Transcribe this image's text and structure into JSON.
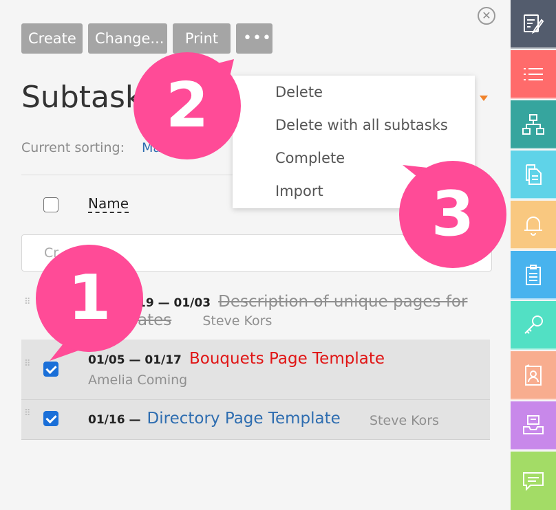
{
  "toolbar": {
    "create_label": "Create",
    "change_label": "Change...",
    "print_label": "Print",
    "more_label": "•••"
  },
  "panel": {
    "title": "Subtasks",
    "sorting_label": "Current sorting:",
    "sorting_value": "Ma"
  },
  "table": {
    "name_header": "Name",
    "new_task_placeholder": "Cr"
  },
  "rows": [
    {
      "dates": "19 — 01/03",
      "name": "Description of unique pages for",
      "name_cont": "ates",
      "assignee": "Steve Kors",
      "checked": false,
      "status": "completed"
    },
    {
      "dates": "01/05 — 01/17",
      "name": "Bouquets Page Template",
      "assignee": "Amelia Coming",
      "checked": true,
      "status": "overdue"
    },
    {
      "dates": "01/16 —",
      "name": "Directory Page Template",
      "assignee": "Steve Kors",
      "checked": true,
      "status": "normal"
    }
  ],
  "menu": {
    "items": [
      "Delete",
      "Delete with all subtasks",
      "Complete",
      "Import"
    ]
  },
  "badges": [
    "1",
    "2",
    "3"
  ],
  "sidebar": {
    "items": [
      {
        "icon": "edit-icon",
        "color": "#535c6d"
      },
      {
        "icon": "list-icon",
        "color": "#ff6b6b"
      },
      {
        "icon": "hierarchy-icon",
        "color": "#36a59e"
      },
      {
        "icon": "documents-icon",
        "color": "#5fd3e8"
      },
      {
        "icon": "bell-icon",
        "color": "#f9c880"
      },
      {
        "icon": "clipboard-icon",
        "color": "#48b3ee"
      },
      {
        "icon": "key-icon",
        "color": "#52e0c4"
      },
      {
        "icon": "contact-card-icon",
        "color": "#f8ad8f"
      },
      {
        "icon": "inbox-tray-icon",
        "color": "#c888ea"
      },
      {
        "icon": "chat-icon",
        "color": "#a3dc66"
      }
    ]
  },
  "colors": {
    "accent": "#2e6db0",
    "overdue": "#e01515",
    "badge": "#ff4b97",
    "toolbar_button": "#a5a5a5"
  }
}
